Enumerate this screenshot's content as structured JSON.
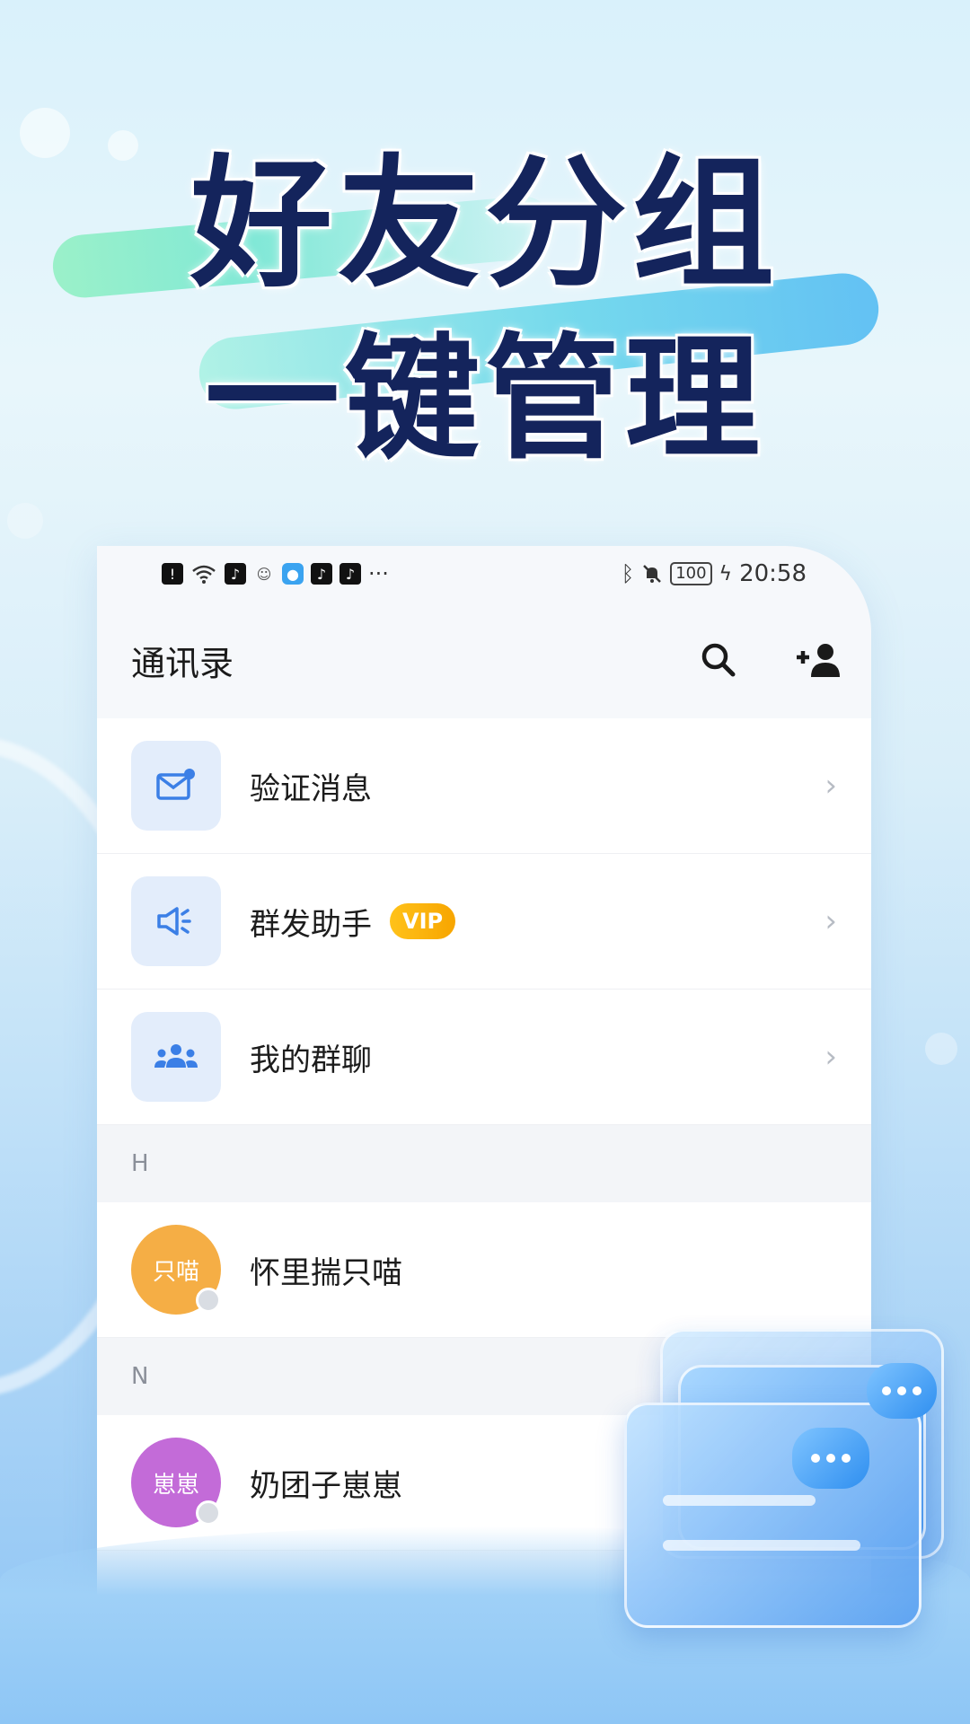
{
  "promo": {
    "headline_line1": "好友分组",
    "headline_line2": "一键管理"
  },
  "status_bar": {
    "time": "20:58",
    "battery": "100",
    "more": "···"
  },
  "app_bar": {
    "title": "通讯录"
  },
  "menu": [
    {
      "label": "验证消息",
      "icon": "mail-icon"
    },
    {
      "label": "群发助手",
      "icon": "megaphone-icon",
      "badge": "VIP"
    },
    {
      "label": "我的群聊",
      "icon": "group-icon"
    }
  ],
  "sections": [
    {
      "letter": "H",
      "contacts": [
        {
          "avatar_text": "只喵",
          "name": "怀里揣只喵",
          "avatar_color": "#f5ae45"
        }
      ]
    },
    {
      "letter": "N",
      "contacts": [
        {
          "avatar_text": "崽崽",
          "name": "奶团子崽崽",
          "avatar_color": "#c36bd8"
        }
      ]
    }
  ],
  "colors": {
    "headline": "#14245c",
    "accent": "#3b7fe6",
    "vip": "#f7a500"
  }
}
